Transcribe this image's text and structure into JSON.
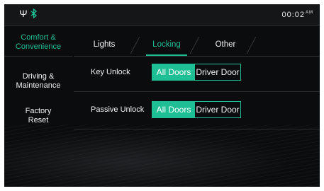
{
  "status_bar": {
    "usb_icon": "usb-icon",
    "bluetooth_icon": "bluetooth-icon",
    "time": "00:02",
    "ampm": "AM"
  },
  "sidebar": {
    "items": [
      {
        "label": "Comfort &\nConvenience",
        "active": true
      },
      {
        "label": "Driving &\nMaintenance",
        "active": false
      },
      {
        "label": "Factory\nReset",
        "active": false
      }
    ]
  },
  "tabs": [
    {
      "label": "Lights",
      "active": false
    },
    {
      "label": "Locking",
      "active": true
    },
    {
      "label": "Other",
      "active": false
    }
  ],
  "settings": [
    {
      "label": "Key Unlock",
      "options": [
        "All Doors",
        "Driver Door"
      ],
      "selected": "All Doors"
    },
    {
      "label": "Passive Unlock",
      "options": [
        "All Doors",
        "Driver Door"
      ],
      "selected": "All Doors"
    }
  ],
  "colors": {
    "accent": "#1fbf96",
    "background": "#0b0c0e"
  }
}
